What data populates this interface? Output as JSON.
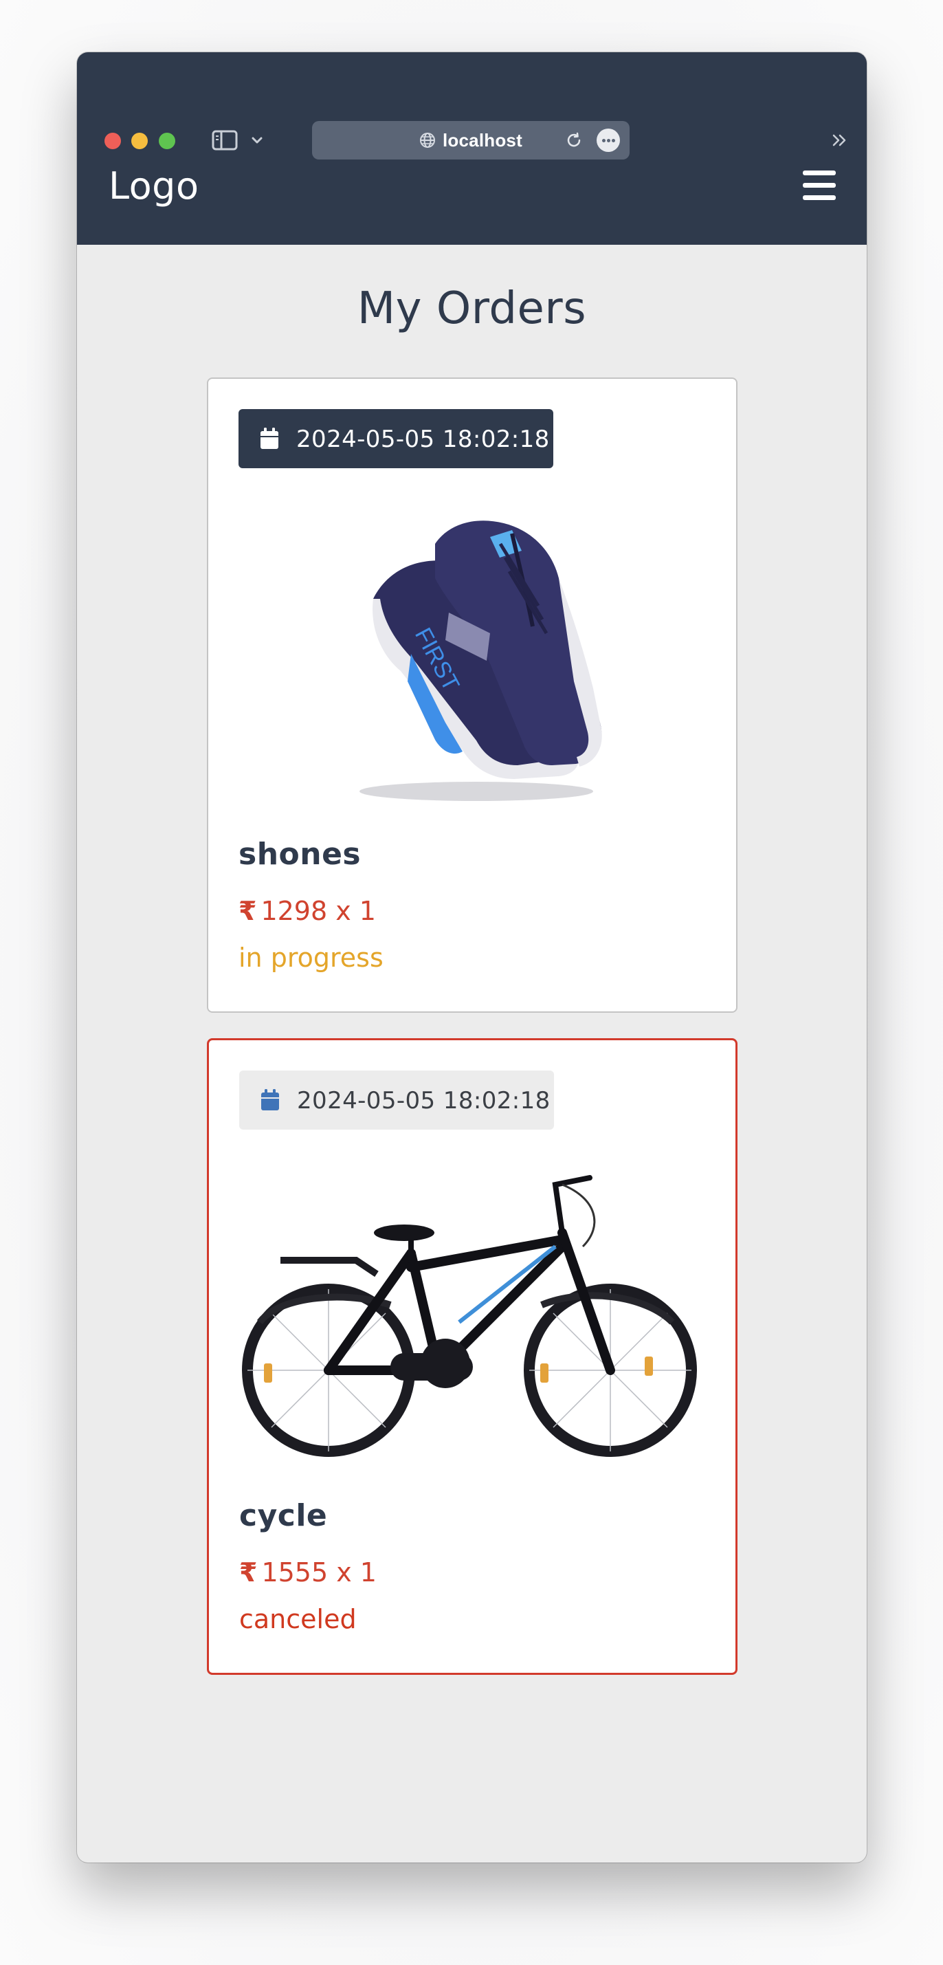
{
  "browser": {
    "url": "localhost"
  },
  "navbar": {
    "logo": "Logo",
    "menu_icon": "hamburger-menu-icon"
  },
  "page": {
    "title": "My Orders"
  },
  "orders": [
    {
      "date": "2024-05-05 18:02:18",
      "name": "shones",
      "currency": "₹",
      "price": "1298 x 1",
      "status": "in progress",
      "status_color": "#e4a52a",
      "image": "sneaker-image"
    },
    {
      "date": "2024-05-05 18:02:18",
      "name": "cycle",
      "currency": "₹",
      "price": "1555 x 1",
      "status": "canceled",
      "status_color": "#d0391f",
      "image": "bicycle-image"
    }
  ],
  "colors": {
    "navbar": "#2f3a4c",
    "price": "#d0432f",
    "canceled_border": "#d23a2c"
  }
}
